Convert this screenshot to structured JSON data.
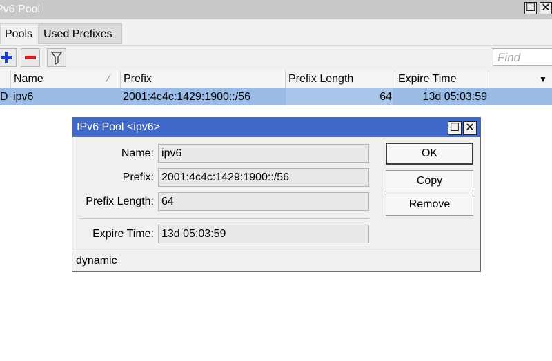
{
  "window": {
    "title": "Pv6 Pool"
  },
  "tabs": [
    {
      "label": "Pools"
    },
    {
      "label": "Used Prefixes"
    }
  ],
  "toolbar": {
    "find_placeholder": "Find"
  },
  "table": {
    "columns": [
      "Name",
      "Prefix",
      "Prefix Length",
      "Expire Time"
    ],
    "rows": [
      {
        "flag": "D",
        "name": "ipv6",
        "prefix": "2001:4c4c:1429:1900::/56",
        "prefix_length": "64",
        "expire_time": "13d 05:03:59"
      }
    ]
  },
  "dialog": {
    "title": "IPv6 Pool <ipv6>",
    "fields": {
      "name_label": "Name:",
      "name_value": "ipv6",
      "prefix_label": "Prefix:",
      "prefix_value": "2001:4c4c:1429:1900::/56",
      "prefix_length_label": "Prefix Length:",
      "prefix_length_value": "64",
      "expire_time_label": "Expire Time:",
      "expire_time_value": "13d 05:03:59"
    },
    "buttons": {
      "ok": "OK",
      "copy": "Copy",
      "remove": "Remove"
    },
    "status": "dynamic"
  },
  "colors": {
    "dialog_title_bg": "#4169c9",
    "selected_row_bg": "#99bbe6",
    "add_icon": "#1b3fbf",
    "remove_icon": "#d02020"
  }
}
